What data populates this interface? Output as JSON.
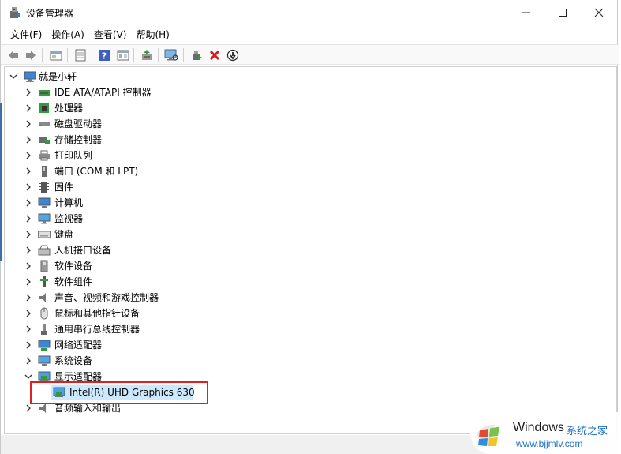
{
  "window": {
    "title": "设备管理器",
    "app_icon": "device-manager-icon",
    "controls": [
      "minimize-icon",
      "maximize-icon",
      "close-icon"
    ]
  },
  "menu": [
    "文件(F)",
    "操作(A)",
    "查看(V)",
    "帮助(H)"
  ],
  "toolbar": [
    "back-arrow-icon",
    "forward-arrow-icon",
    "properties-icon",
    "show-hidden-icon",
    "help-icon",
    "view-resources-icon",
    "update-driver-icon",
    "scan-hardware-icon",
    "enable-device-icon",
    "uninstall-icon",
    "disable-download-icon"
  ],
  "tree": {
    "root": "就是小轩",
    "categories": [
      {
        "label": "IDE ATA/ATAPI 控制器",
        "icon": "ide-controller-icon"
      },
      {
        "label": "处理器",
        "icon": "processor-icon"
      },
      {
        "label": "磁盘驱动器",
        "icon": "disk-drive-icon"
      },
      {
        "label": "存储控制器",
        "icon": "storage-controller-icon"
      },
      {
        "label": "打印队列",
        "icon": "printer-icon"
      },
      {
        "label": "端口 (COM 和 LPT)",
        "icon": "port-icon"
      },
      {
        "label": "固件",
        "icon": "firmware-icon"
      },
      {
        "label": "计算机",
        "icon": "computer-icon"
      },
      {
        "label": "监视器",
        "icon": "monitor-icon"
      },
      {
        "label": "键盘",
        "icon": "keyboard-icon"
      },
      {
        "label": "人机接口设备",
        "icon": "hid-icon"
      },
      {
        "label": "软件设备",
        "icon": "software-device-icon"
      },
      {
        "label": "软件组件",
        "icon": "software-component-icon"
      },
      {
        "label": "声音、视频和游戏控制器",
        "icon": "sound-icon"
      },
      {
        "label": "鼠标和其他指针设备",
        "icon": "mouse-icon"
      },
      {
        "label": "通用串行总线控制器",
        "icon": "usb-icon"
      },
      {
        "label": "网络适配器",
        "icon": "network-adapter-icon"
      },
      {
        "label": "系统设备",
        "icon": "system-device-icon"
      },
      {
        "label": "显示适配器",
        "icon": "display-adapter-icon",
        "expanded": true
      },
      {
        "label": "音频输入和输出",
        "icon": "audio-io-icon"
      }
    ],
    "display_child": {
      "label": "Intel(R) UHD Graphics 630",
      "icon": "display-adapter-icon",
      "selected": true
    }
  },
  "watermark": {
    "brand": "Windows",
    "site": "系统之家",
    "url": "www.bjjmlv.com"
  },
  "colors": {
    "selection": "#cce8ff",
    "highlight_box": "#e02020",
    "watermark_blue": "#1f6fc4"
  }
}
